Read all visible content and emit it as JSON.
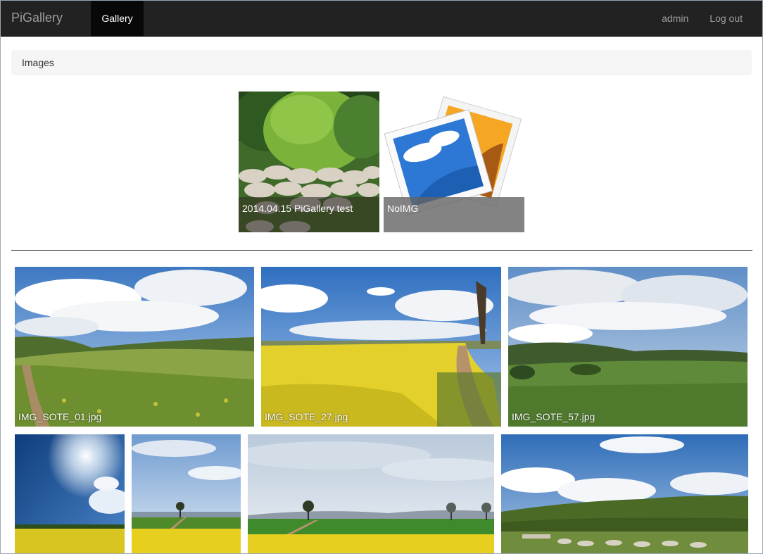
{
  "navbar": {
    "brand": "PiGallery",
    "active_tab": "Gallery",
    "user": "admin",
    "logout": "Log out"
  },
  "breadcrumb": {
    "current": "Images"
  },
  "directories": [
    {
      "name": "2014.04.15 PiGallery test"
    },
    {
      "name": "NoIMG"
    }
  ],
  "photos": [
    {
      "name": "IMG_SOTE_01.jpg"
    },
    {
      "name": "IMG_SOTE_27.jpg"
    },
    {
      "name": "IMG_SOTE_57.jpg"
    },
    {
      "name": ""
    },
    {
      "name": ""
    },
    {
      "name": ""
    },
    {
      "name": ""
    }
  ],
  "colors": {
    "navbar_bg": "#222222",
    "nav_active_bg": "#080808",
    "nav_text": "#9d9d9d",
    "breadcrumb_bg": "#f5f5f5"
  }
}
